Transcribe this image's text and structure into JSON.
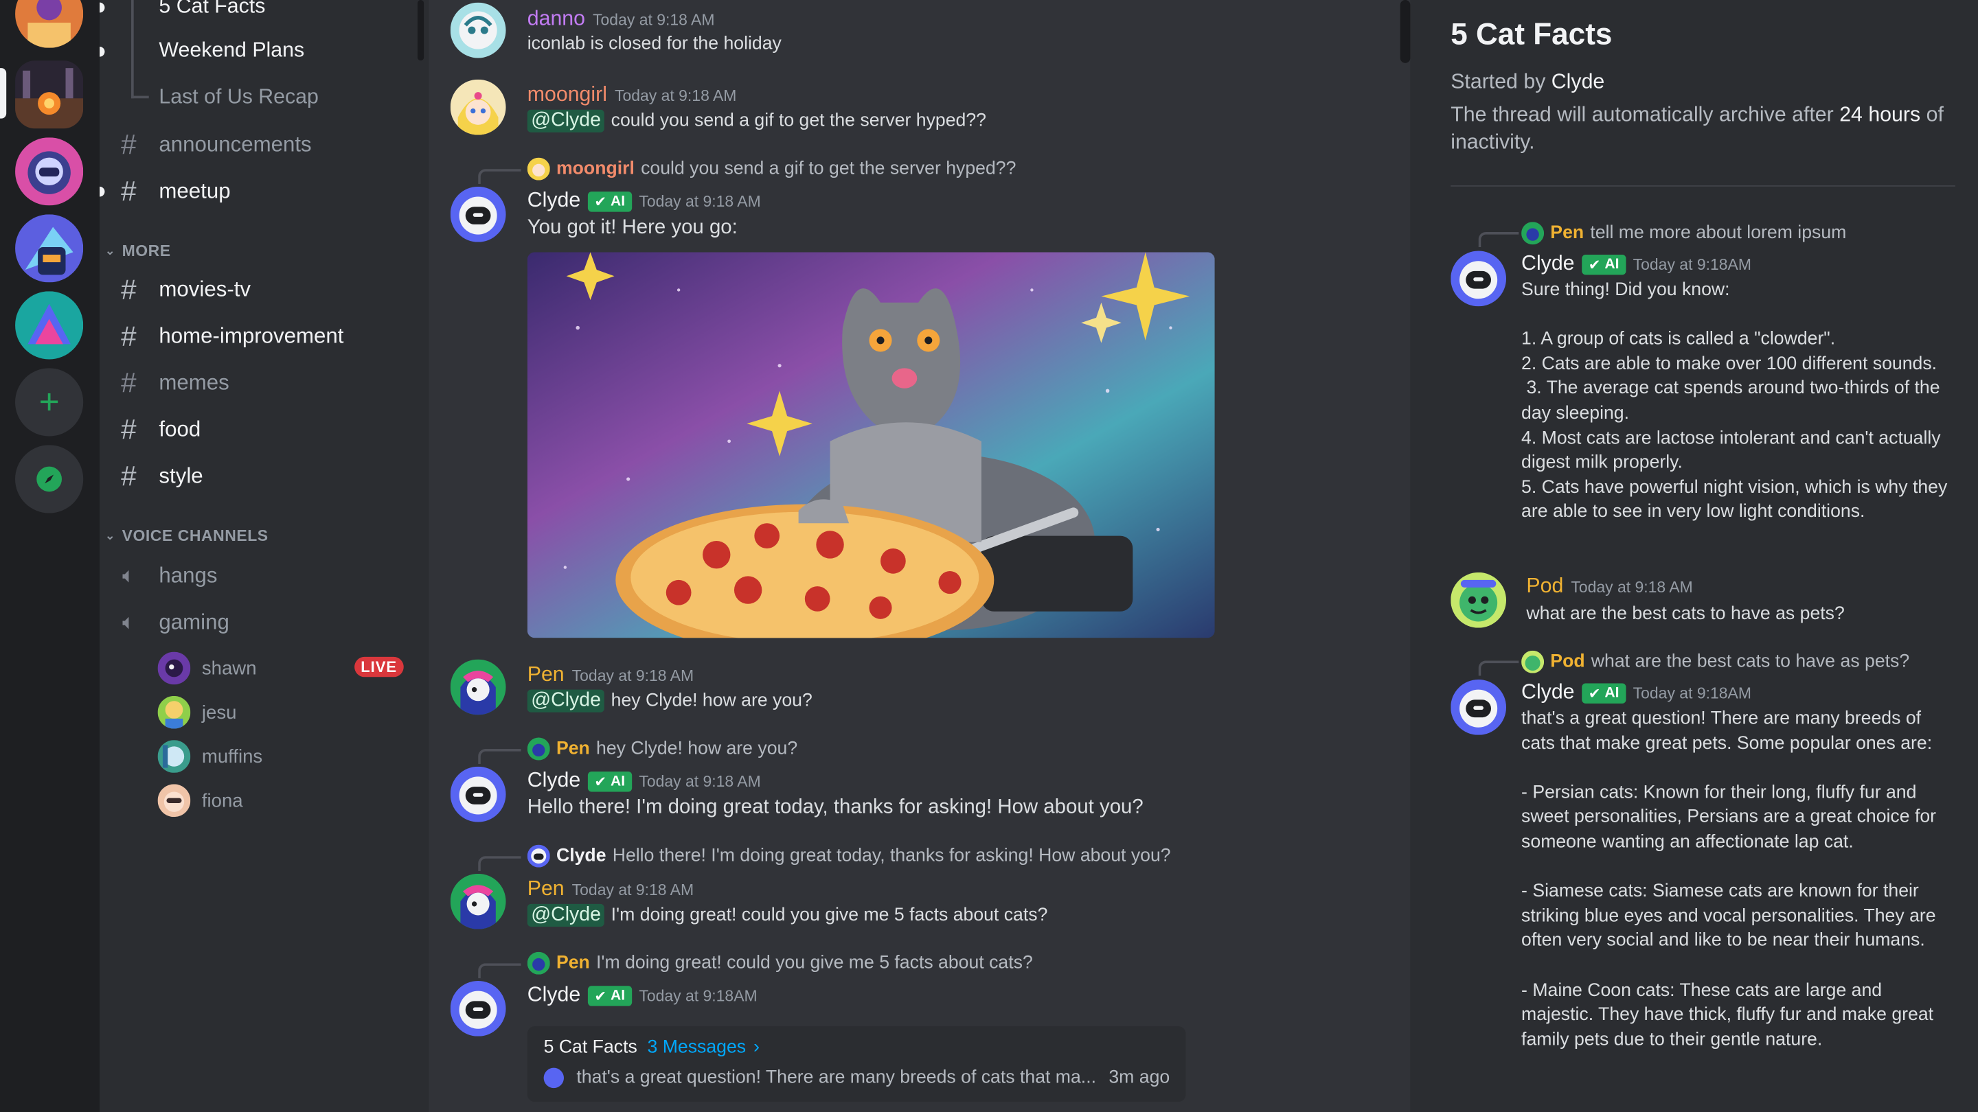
{
  "colors": {
    "mention_bg": "#1f5b43",
    "ai_badge": "#23a559",
    "live_badge": "#da373c",
    "danno": "#c27cf3",
    "moongirl": "#f28b6b",
    "pen": "#f0b232",
    "pod": "#f0b232",
    "clyde": "#f2f3f5"
  },
  "sidebar": {
    "threads": [
      "5 Cat Facts",
      "Weekend Plans",
      "Last of Us Recap"
    ],
    "channels_top": [
      "announcements",
      "meetup"
    ],
    "more_label": "MORE",
    "more_channels": [
      "movies-tv",
      "home-improvement",
      "memes",
      "food",
      "style"
    ],
    "voice_label": "VOICE CHANNELS",
    "voice_channels": [
      "hangs",
      "gaming"
    ],
    "voice_users": [
      "shawn",
      "jesu",
      "muffins",
      "fiona"
    ],
    "live_label": "LIVE"
  },
  "chat": {
    "m1": {
      "user": "danno",
      "time": "Today at 9:18 AM",
      "text": "iconlab is closed for the holiday"
    },
    "m2": {
      "user": "moongirl",
      "time": "Today at 9:18 AM",
      "mention": "@Clyde",
      "text": "could you send a gif to get the server hyped??"
    },
    "m3": {
      "reply_user": "moongirl",
      "reply_text": "could you send a gif to get the server hyped??",
      "user": "Clyde",
      "badge": "AI",
      "time": "Today at 9:18 AM",
      "text": "You got it! Here you go:"
    },
    "m4": {
      "user": "Pen",
      "time": "Today at 9:18 AM",
      "mention": "@Clyde",
      "text": "hey Clyde! how are you?"
    },
    "m5": {
      "reply_user": "Pen",
      "reply_text": "hey Clyde! how are you?",
      "user": "Clyde",
      "badge": "AI",
      "time": "Today at 9:18 AM",
      "text": "Hello there! I'm doing great today, thanks for asking! How about you?"
    },
    "m6": {
      "reply_user": "Clyde",
      "reply_text": "Hello there! I'm doing great today, thanks for asking! How about you?",
      "user": "Pen",
      "time": "Today at 9:18 AM",
      "mention": "@Clyde",
      "text": "I'm doing great! could you give me 5 facts about cats?"
    },
    "m7": {
      "reply_user": "Pen",
      "reply_text": "I'm doing great! could you give me 5 facts about cats?",
      "user": "Clyde",
      "badge": "AI",
      "time": "Today at 9:18AM"
    },
    "thread_card": {
      "name": "5 Cat Facts",
      "count": "3 Messages",
      "preview": "that's a great question! There are many breeds of cats that ma...",
      "age": "3m ago"
    }
  },
  "panel": {
    "title": "5 Cat Facts",
    "started_prefix": "Started by",
    "started_user": "Clyde",
    "archive_prefix": "The thread will automatically archive after",
    "archive_strong": "24 hours",
    "archive_suffix": "of inactivity.",
    "p1": {
      "reply_user": "Pen",
      "reply_text": "tell me more about lorem ipsum",
      "user": "Clyde",
      "badge": "AI",
      "time": "Today at 9:18AM",
      "body": "Sure thing! Did you know:\n\n1. A group of cats is called a \"clowder\".\n2. Cats are able to make over 100 different sounds.\n 3. The average cat spends around two-thirds of the day sleeping.\n4. Most cats are lactose intolerant and can't actually digest milk properly.\n5. Cats have powerful night vision, which is why they are able to see in very low light conditions."
    },
    "p2": {
      "user": "Pod",
      "time": "Today at 9:18 AM",
      "text": "what are the best cats to have as pets?"
    },
    "p3": {
      "reply_user": "Pod",
      "reply_text": "what are the best cats to have as pets?",
      "user": "Clyde",
      "badge": "AI",
      "time": "Today at 9:18AM",
      "body": "that's a great question! There are many breeds of cats that make great pets. Some popular ones are:\n\n- Persian cats: Known for their long, fluffy fur and sweet personalities, Persians are a great choice for someone wanting an affectionate lap cat.\n\n- Siamese cats: Siamese cats are known for their striking blue eyes and vocal personalities. They are often very social and like to be near their humans.\n\n- Maine Coon cats: These cats are large and majestic. They have thick, fluffy fur and make great family pets due to their gentle nature."
    }
  }
}
